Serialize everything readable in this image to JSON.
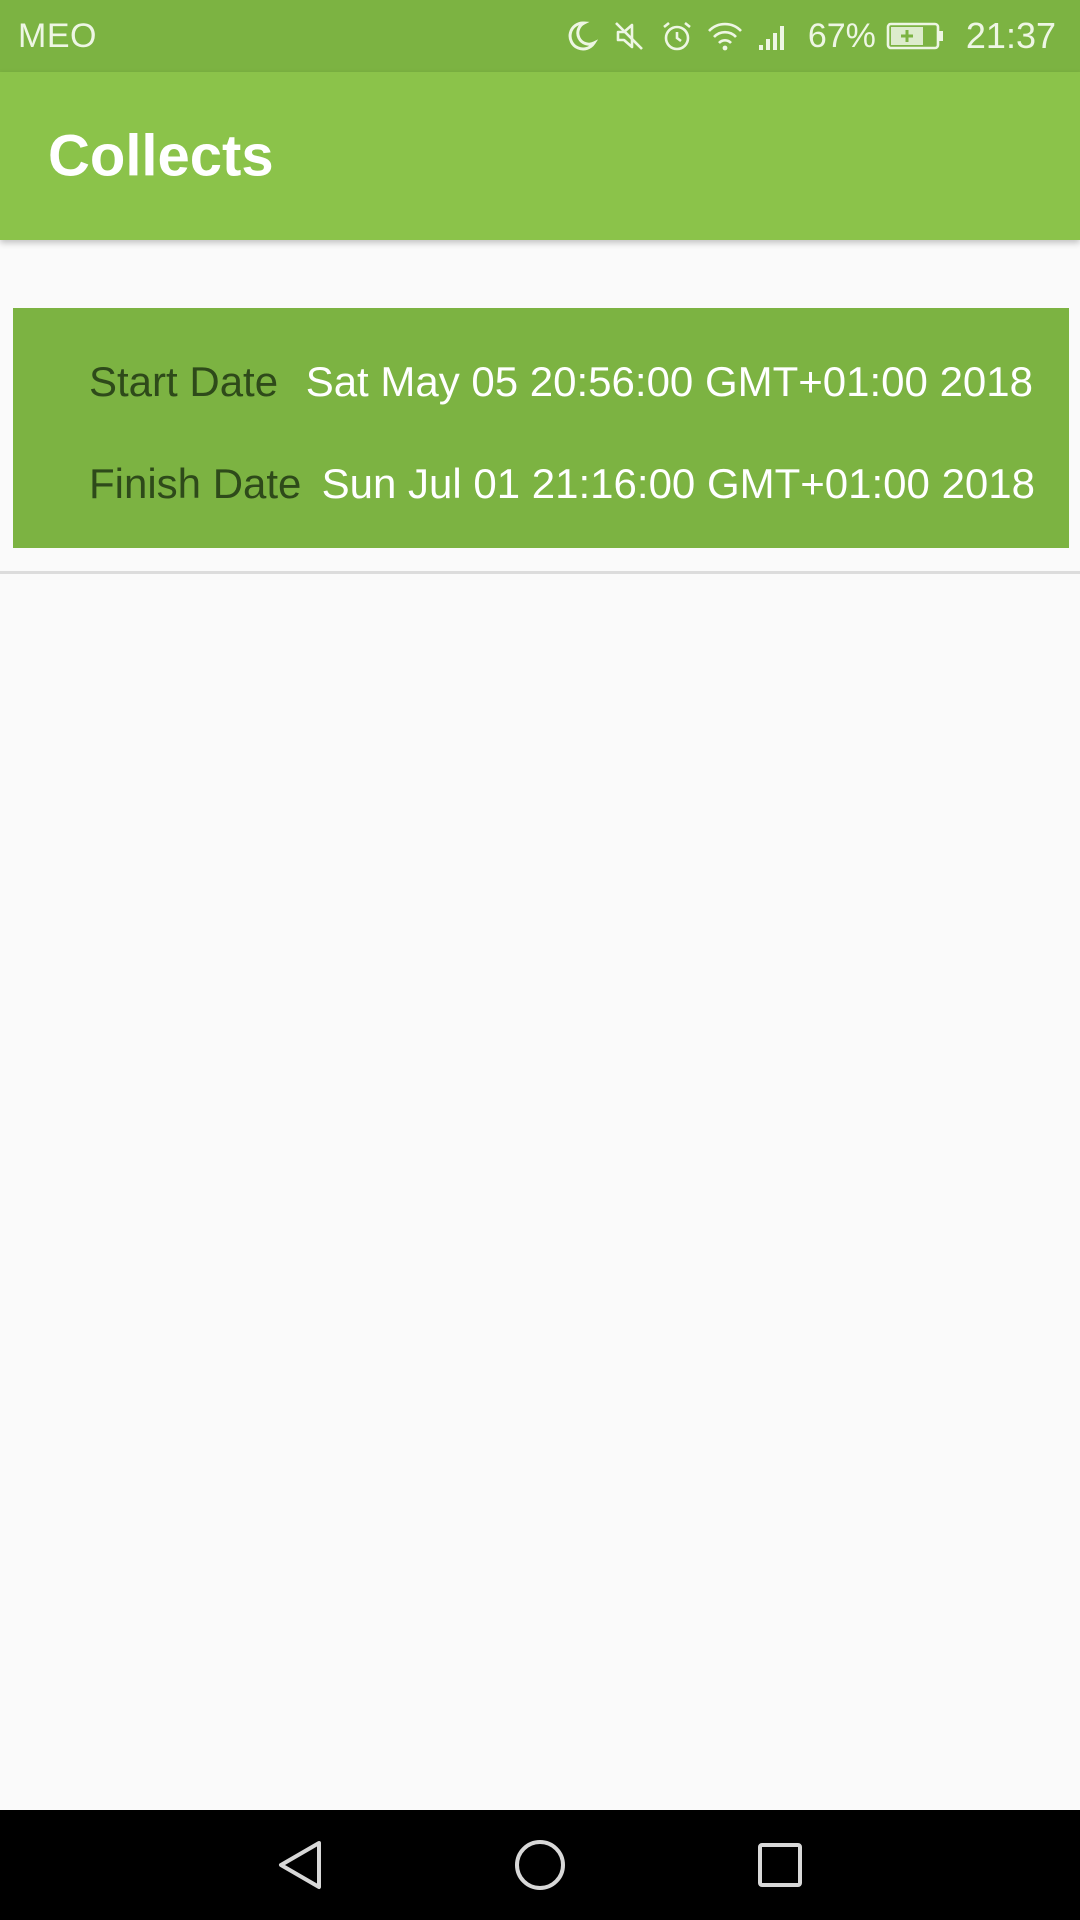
{
  "status_bar": {
    "carrier": "MEO",
    "battery_percent": "67%",
    "time": "21:37",
    "icons": [
      "moon-icon",
      "mute-icon",
      "alarm-icon",
      "wifi-icon",
      "signal-icon",
      "battery-icon"
    ]
  },
  "app_bar": {
    "title": "Collects"
  },
  "collects": [
    {
      "start_label": "Start Date",
      "start_value": "Sat May 05 20:56:00 GMT+01:00 2018",
      "finish_label": "Finish Date",
      "finish_value": "Sun Jul 01 21:16:00 GMT+01:00 2018"
    }
  ],
  "nav_bar": {
    "buttons": [
      "back-icon",
      "home-icon",
      "recents-icon"
    ]
  },
  "colors": {
    "status_bar": "#7cb342",
    "app_bar": "#8bc34a",
    "card": "#7cb342",
    "label_text": "#2e4a1a",
    "background": "#fafafa"
  }
}
